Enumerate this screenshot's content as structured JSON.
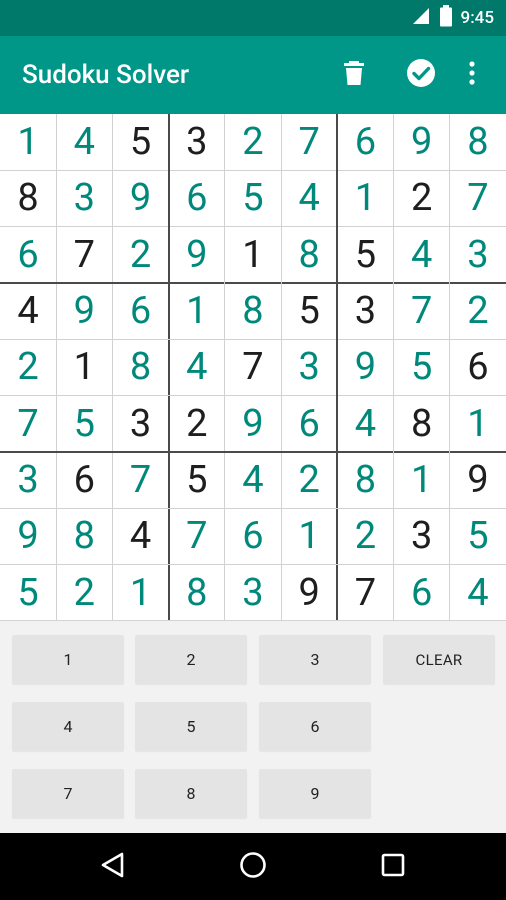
{
  "status_bar": {
    "time": "9:45",
    "icons": [
      "signal-icon",
      "battery-icon"
    ]
  },
  "app_bar": {
    "title": "Sudoku Solver",
    "actions": [
      "delete-icon",
      "check-circle-icon",
      "more-vert-icon"
    ]
  },
  "colors": {
    "primary": "#009688",
    "primary_dark": "#00796b",
    "solved_digit": "#00897b",
    "given_digit": "#1e1e1e"
  },
  "grid": {
    "values": [
      [
        1,
        4,
        5,
        3,
        2,
        7,
        6,
        9,
        8
      ],
      [
        8,
        3,
        9,
        6,
        5,
        4,
        1,
        2,
        7
      ],
      [
        6,
        7,
        2,
        9,
        1,
        8,
        5,
        4,
        3
      ],
      [
        4,
        9,
        6,
        1,
        8,
        5,
        3,
        7,
        2
      ],
      [
        2,
        1,
        8,
        4,
        7,
        3,
        9,
        5,
        6
      ],
      [
        7,
        5,
        3,
        2,
        9,
        6,
        4,
        8,
        1
      ],
      [
        3,
        6,
        7,
        5,
        4,
        2,
        8,
        1,
        9
      ],
      [
        9,
        8,
        4,
        7,
        6,
        1,
        2,
        3,
        5
      ],
      [
        5,
        2,
        1,
        8,
        3,
        9,
        7,
        6,
        4
      ]
    ],
    "given": [
      [
        0,
        0,
        1,
        1,
        0,
        0,
        0,
        0,
        0
      ],
      [
        1,
        0,
        0,
        0,
        0,
        0,
        0,
        1,
        0
      ],
      [
        0,
        1,
        0,
        0,
        1,
        0,
        1,
        0,
        0
      ],
      [
        1,
        0,
        0,
        0,
        0,
        1,
        1,
        0,
        0
      ],
      [
        0,
        1,
        0,
        0,
        1,
        0,
        0,
        0,
        1
      ],
      [
        0,
        0,
        1,
        1,
        0,
        0,
        0,
        1,
        0
      ],
      [
        0,
        1,
        0,
        1,
        0,
        0,
        0,
        0,
        1
      ],
      [
        0,
        0,
        1,
        0,
        0,
        0,
        0,
        1,
        0
      ],
      [
        0,
        0,
        0,
        0,
        0,
        1,
        1,
        0,
        0
      ]
    ]
  },
  "keypad": {
    "keys": [
      "1",
      "2",
      "3",
      "CLEAR",
      "4",
      "5",
      "6",
      "7",
      "8",
      "9"
    ]
  },
  "nav_bar": {
    "buttons": [
      "back-icon",
      "home-icon",
      "recents-icon"
    ]
  }
}
